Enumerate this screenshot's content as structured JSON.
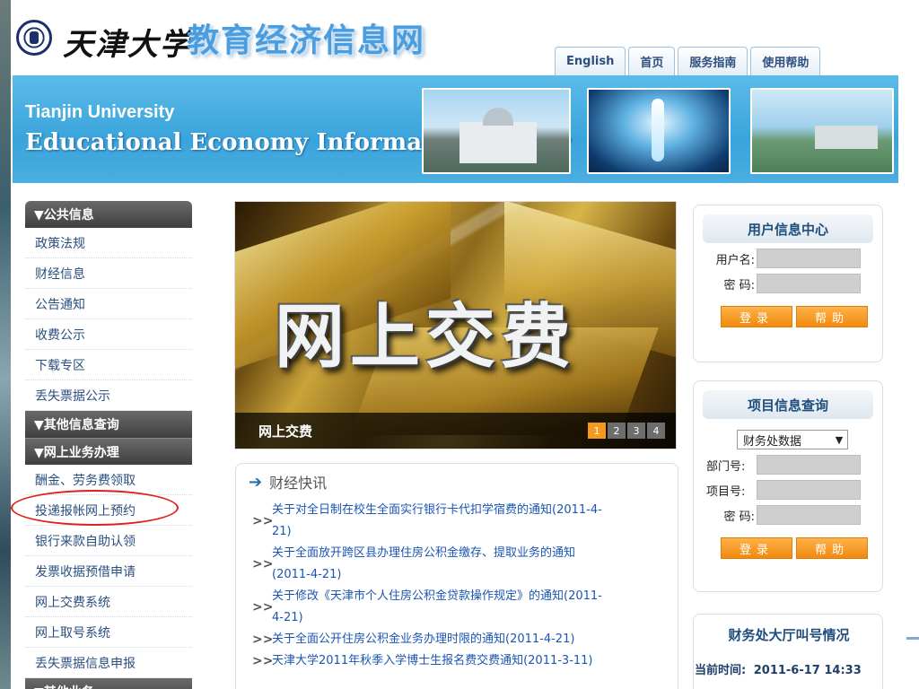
{
  "header": {
    "university": "天津大学",
    "site_title": "教育经济信息网",
    "tabs": [
      "English",
      "首页",
      "服务指南",
      "使用帮助"
    ]
  },
  "banner": {
    "line1": "Tianjin University",
    "line2": "Educational Economy Information Center"
  },
  "leftnav": {
    "sections": [
      {
        "title": "▼公共信息",
        "items": [
          "政策法规",
          "财经信息",
          "公告通知",
          "收费公示",
          "下载专区",
          "丢失票据公示"
        ]
      },
      {
        "title": "▼其他信息查询",
        "items": []
      },
      {
        "title": "▼网上业务办理",
        "items": [
          "酬金、劳务费领取",
          "投递报帐网上预约",
          "银行来款自助认领",
          "发票收据预借申请",
          "网上交费系统",
          "网上取号系统",
          "丢失票据信息申报"
        ]
      },
      {
        "title": "▼其他业务",
        "items": []
      }
    ]
  },
  "slideshow": {
    "big_text": "网上交费",
    "caption": "网上交费",
    "pages": [
      "1",
      "2",
      "3",
      "4"
    ],
    "active_page": "1"
  },
  "news": {
    "title": "财经快讯",
    "items": [
      {
        "line1": "关于对全日制在校生全面实行银行卡代扣学宿费的通知(2011-4-",
        "line2": "21)"
      },
      {
        "line1": "关于全面放开跨区县办理住房公积金缴存、提取业务的通知",
        "line2": "(2011-4-21)"
      },
      {
        "line1": "关于修改《天津市个人住房公积金贷款操作规定》的通知(2011-",
        "line2": "4-21)"
      },
      {
        "line1": "关于全面公开住房公积金业务办理时限的通知(2011-4-21)",
        "line2": ""
      },
      {
        "line1": "天津大学2011年秋季入学博士生报名费交费通知(2011-3-11)",
        "line2": ""
      }
    ]
  },
  "user_center": {
    "title": "用户信息中心",
    "username_label": "用户名:",
    "password_label": "密  码:",
    "login": "登录",
    "help": "帮助"
  },
  "project_query": {
    "title": "项目信息查询",
    "select_value": "财务处数据",
    "dept_label": "部门号:",
    "project_label": "项目号:",
    "password_label": "密  码:",
    "login": "登录",
    "help": "帮助"
  },
  "hall": {
    "title": "财务处大厅叫号情况",
    "time_label": "当前时间:",
    "time_value": "2011-6-17  14:33"
  },
  "colors": {
    "accent_blue": "#4a9ee0",
    "banner_blue": "#3aa4dc",
    "orange_button": "#f08a0e",
    "nav_dark": "#3f3f3f",
    "link_blue": "#1a55b3",
    "highlight_red": "#e01e1e"
  }
}
